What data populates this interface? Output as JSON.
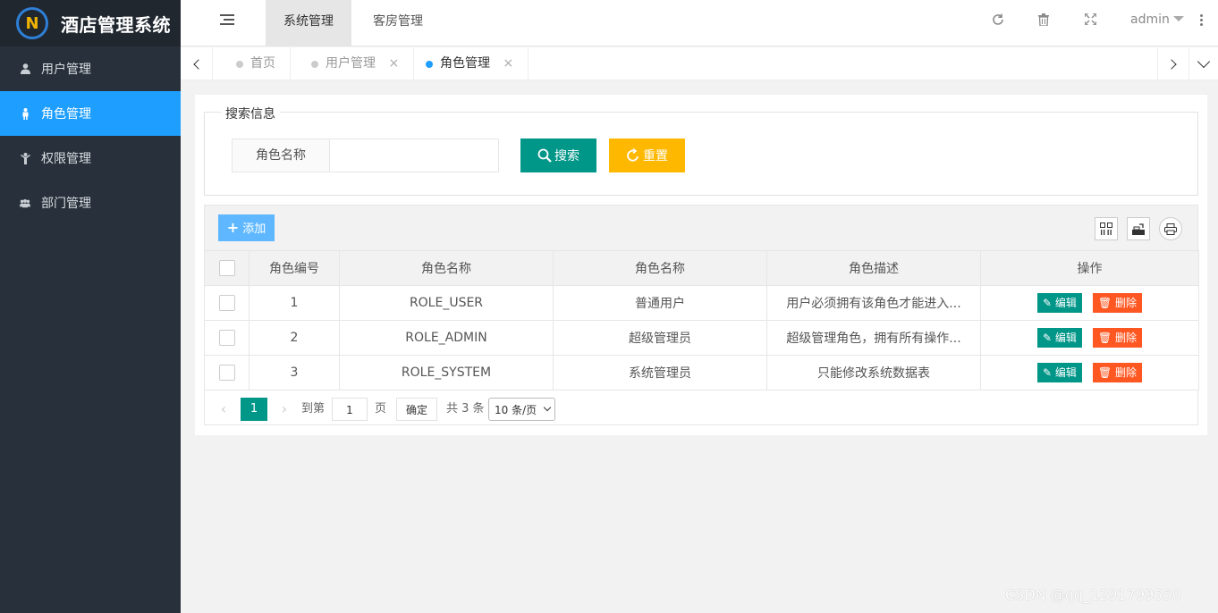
{
  "app": {
    "logo_letter": "N",
    "title": "酒店管理系统"
  },
  "sidebar": {
    "items": [
      {
        "label": "用户管理",
        "icon": "user-icon",
        "active": false
      },
      {
        "label": "角色管理",
        "icon": "person-icon",
        "active": true
      },
      {
        "label": "权限管理",
        "icon": "key-person-icon",
        "active": false
      },
      {
        "label": "部门管理",
        "icon": "group-icon",
        "active": false
      }
    ]
  },
  "header": {
    "tabs": [
      {
        "label": "系统管理",
        "active": true
      },
      {
        "label": "客房管理",
        "active": false
      }
    ],
    "icons": [
      "refresh-icon",
      "trash-icon",
      "fullscreen-icon"
    ],
    "user": "admin"
  },
  "tabbar": {
    "tabs": [
      {
        "label": "首页",
        "closable": false,
        "active": false
      },
      {
        "label": "用户管理",
        "closable": true,
        "active": false
      },
      {
        "label": "角色管理",
        "closable": true,
        "active": true
      }
    ],
    "close_glyph": "×"
  },
  "search": {
    "legend": "搜索信息",
    "field_label": "角色名称",
    "field_value": "",
    "search_button": "搜索",
    "reset_button": "重置"
  },
  "toolbar": {
    "add_button": "添加"
  },
  "table": {
    "headers": [
      "角色编号",
      "角色名称",
      "角色名称",
      "角色描述",
      "操作"
    ],
    "rows": [
      {
        "id": "1",
        "code": "ROLE_USER",
        "name": "普通用户",
        "desc": "用户必须拥有该角色才能进入..."
      },
      {
        "id": "2",
        "code": "ROLE_ADMIN",
        "name": "超级管理员",
        "desc": "超级管理角色，拥有所有操作..."
      },
      {
        "id": "3",
        "code": "ROLE_SYSTEM",
        "name": "系统管理员",
        "desc": "只能修改系统数据表"
      }
    ],
    "edit_label": "编辑",
    "delete_label": "删除"
  },
  "pager": {
    "current": "1",
    "goto_label": "到第",
    "goto_value": "1",
    "page_unit": "页",
    "confirm": "确定",
    "total": "共 3 条",
    "page_size": "10 条/页"
  },
  "watermark": "CSDN @qq_1291799550",
  "colors": {
    "primary": "#009688",
    "accent": "#1e9fff",
    "warning": "#ffb800",
    "danger": "#ff5722",
    "sidebar": "#28313b"
  }
}
